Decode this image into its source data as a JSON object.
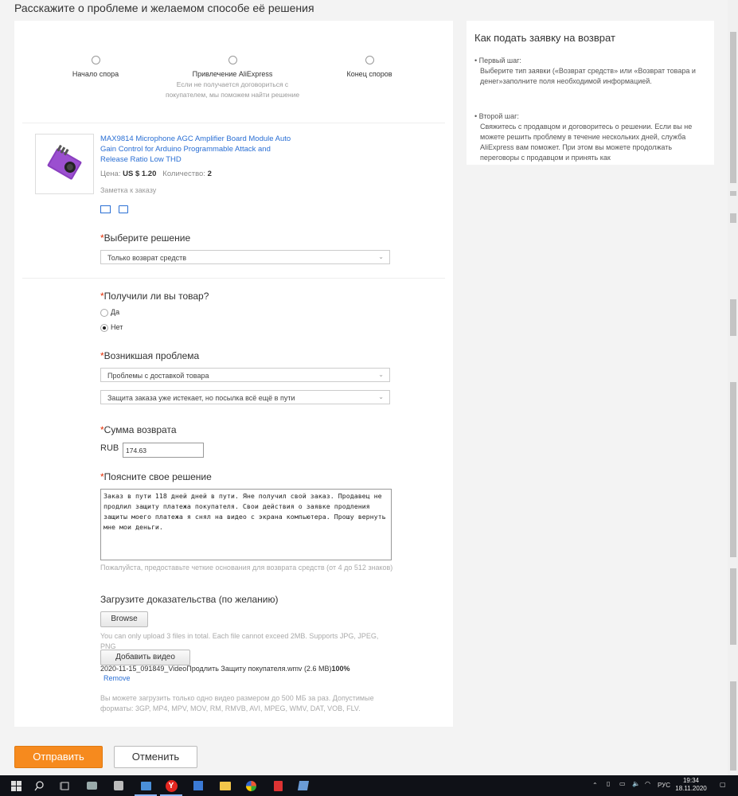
{
  "page": {
    "title": "Расскажите о проблеме и желаемом способе её решения"
  },
  "steps": [
    {
      "label": "Начало спора",
      "sub": ""
    },
    {
      "label": "Привлечение AliExpress",
      "sub": "Если не получается договориться с покупателем, мы поможем найти решение"
    },
    {
      "label": "Конец споров",
      "sub": ""
    }
  ],
  "product": {
    "title": "MAX9814 Microphone AGC Amplifier Board Module Auto Gain Control for Arduino Programmable Attack and Release Ratio Low THD",
    "price_label": "Цена:",
    "price": "US $ 1.20",
    "qty_label": "Количество:",
    "qty": "2",
    "note": "Заметка к заказу"
  },
  "solution": {
    "required": "*",
    "label": "Выберите решение",
    "selected": "Только возврат средств"
  },
  "received": {
    "required": "*",
    "label": "Получили ли вы товар?",
    "options": [
      "Да",
      "Нет"
    ],
    "selected_index": 1
  },
  "problem": {
    "required": "*",
    "label": "Возникшая проблема",
    "select1": "Проблемы с доставкой товара",
    "select2": "Защита заказа уже истекает, но посылка всё ещё в пути"
  },
  "refund": {
    "required": "*",
    "label": "Сумма возврата",
    "currency": "RUB",
    "amount": "174.63"
  },
  "explain": {
    "required": "*",
    "label": "Поясните свое решение",
    "text": "Заказ в пути 118 дней дней в пути. Яне получил свой заказ. Продавец не продлил защиту платежа покупателя. Свои действия о заявке продления защиты моего платежа я снял на видео с экрана компьютера. Прошу вернуть мне мои деньги.",
    "hint": "Пожалуйста, предоставьте четкие основания для возврата средств (от 4 до 512 знаков)"
  },
  "upload": {
    "title": "Загрузите доказательства (по желанию)",
    "browse": "Browse",
    "browse_hint": "You can only upload 3 files in total. Each file cannot exceed 2MB. Supports JPG, JPEG, PNG",
    "add_video": "Добавить видео",
    "file_name": "2020-11-15_091849_VideoПродлить Защиту покупателя.wmv (2.6 MB)",
    "file_progress": "100%",
    "remove": "Remove",
    "video_hint": "Вы можете загрузить только одно видео размером до 500 МБ за раз. Допустимые форматы: 3GP, MP4, MPV, MOV, RM, RMVB, AVI, MPEG, WMV, DAT, VOB, FLV."
  },
  "actions": {
    "submit": "Отправить",
    "cancel": "Отменить"
  },
  "help": {
    "title": "Как подать заявку на возврат",
    "steps": [
      {
        "head": "• Первый шаг:",
        "body": "Выберите тип заявки («Возврат средств» или «Возврат товара и денег»заполните поля необходимой информацией."
      },
      {
        "head": "• Второй шаг:",
        "body": "Свяжитесь с продавцом и договоритесь о решении. Если вы не можете решить проблему в течение нескольких дней, служба AliExpress вам поможет. При этом вы можете продолжать переговоры с продавцом и принять как"
      }
    ]
  },
  "taskbar": {
    "lang": "РУС",
    "time": "19:34",
    "date": "18.11.2020"
  },
  "colors": {
    "accent": "#f68a1e",
    "link": "#2a6fd4",
    "required": "#e62e04"
  }
}
